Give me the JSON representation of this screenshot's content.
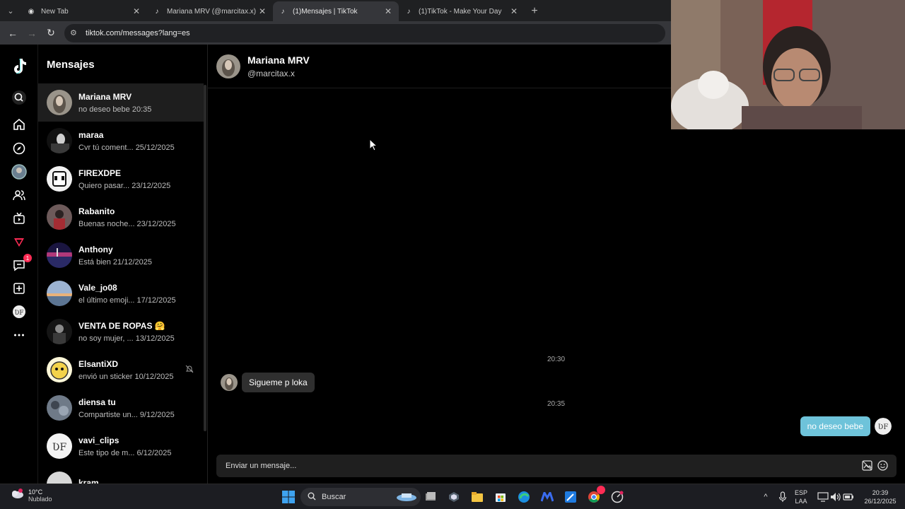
{
  "browser": {
    "tabs": [
      {
        "title": "New Tab",
        "active": false
      },
      {
        "title": "Mariana MRV (@marcitax.x) | TikTok",
        "active": false
      },
      {
        "title": "(1)Mensajes | TikTok",
        "active": true
      },
      {
        "title": "(1)TikTok - Make Your Day",
        "active": false
      }
    ],
    "url": "tiktok.com/messages?lang=es"
  },
  "rail": {
    "items": [
      "tiktok-logo",
      "search",
      "home",
      "explore",
      "profile",
      "following",
      "live",
      "activity",
      "messages",
      "upload",
      "profile-small",
      "more"
    ],
    "messages_badge": "1"
  },
  "conversations": {
    "title": "Mensajes",
    "items": [
      {
        "name": "Mariana MRV",
        "preview": "no deseo bebe 20:35",
        "selected": true
      },
      {
        "name": "maraa",
        "preview": "Cvr tú coment... 25/12/2025"
      },
      {
        "name": "FIREXDPE",
        "preview": "Quiero pasar... 23/12/2025"
      },
      {
        "name": "Rabanito",
        "preview": "Buenas noche... 23/12/2025"
      },
      {
        "name": "Anthony",
        "preview": "Está bien 21/12/2025"
      },
      {
        "name": "Vale_jo08",
        "preview": "el último emoji... 17/12/2025"
      },
      {
        "name": "VENTA DE ROPAS 🤗",
        "preview": "no soy mujer, ... 13/12/2025"
      },
      {
        "name": "ElsantiXD",
        "preview": "envió un sticker 10/12/2025",
        "muted": true
      },
      {
        "name": "diensa tu",
        "preview": "Compartiste un... 9/12/2025"
      },
      {
        "name": "vavi_clips",
        "preview": "Este tipo de m... 6/12/2025"
      },
      {
        "name": "kram",
        "preview": ""
      }
    ]
  },
  "chat": {
    "name": "Mariana MRV",
    "handle": "@marcitax.x",
    "time1": "20:30",
    "msg_in": "Sigueme p loka",
    "time2": "20:35",
    "msg_out": "no deseo bebe",
    "composer_placeholder": "Enviar un mensaje..."
  },
  "taskbar": {
    "temp": "10°C",
    "weather": "Nublado",
    "search": "Buscar",
    "lang1": "ESP",
    "lang2": "LAA",
    "time": "20:39",
    "date": "26/12/2025"
  },
  "colors": {
    "accent": "#fe2c55",
    "bubble_out": "#6ec3da",
    "bubble_in": "#2f2f2f"
  }
}
